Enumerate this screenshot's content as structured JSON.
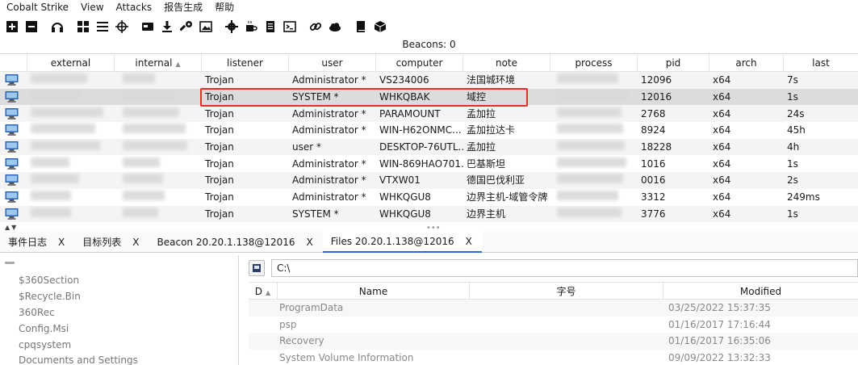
{
  "menu": [
    "Cobalt Strike",
    "View",
    "Attacks",
    "报告生成",
    "帮助"
  ],
  "toolbar_icons": [
    "plus-icon",
    "minus-icon",
    "headphones-icon",
    "targets-icon",
    "list-icon",
    "crosshair-icon",
    "credit-card-icon",
    "download-icon",
    "key-icon",
    "image-icon",
    "gear-icon",
    "coffee-icon",
    "document-icon",
    "terminal-icon",
    "link-icon",
    "cloud-icon",
    "book-icon",
    "cube-icon"
  ],
  "beacons_label": "Beacons: 0",
  "columns": [
    "external",
    "internal",
    "listener",
    "user",
    "computer",
    "note",
    "process",
    "pid",
    "arch",
    "last"
  ],
  "rows": [
    {
      "listener": "Trojan",
      "user": "Administrator *",
      "computer": "VS234006",
      "note": "法国城环境",
      "pid": "12096",
      "arch": "x64",
      "last": "7s"
    },
    {
      "listener": "Trojan",
      "user": "SYSTEM *",
      "computer": "WHKQBAK",
      "note": "域控",
      "pid": "12016",
      "arch": "x64",
      "last": "1s"
    },
    {
      "listener": "Trojan",
      "user": "Administrator *",
      "computer": "PARAMOUNT",
      "note": "孟加拉",
      "pid": "2768",
      "arch": "x64",
      "last": "24s"
    },
    {
      "listener": "Trojan",
      "user": "Administrator *",
      "computer": "WIN-H62ONMC...",
      "note": "孟加拉达卡",
      "pid": "8924",
      "arch": "x64",
      "last": "45h"
    },
    {
      "listener": "Trojan",
      "user": "user *",
      "computer": "DESKTOP-76UTL...",
      "note": "孟加拉",
      "pid": "18228",
      "arch": "x64",
      "last": "4h"
    },
    {
      "listener": "Trojan",
      "user": "Administrator *",
      "computer": "WIN-869HAO701...",
      "note": "巴基斯坦",
      "pid": "1016",
      "arch": "x64",
      "last": "1s"
    },
    {
      "listener": "Trojan",
      "user": "Administrator *",
      "computer": "VTXW01",
      "note": "德国巴伐利亚",
      "pid": "0016",
      "arch": "x64",
      "last": "2s"
    },
    {
      "listener": "Trojan",
      "user": "Administrator *",
      "computer": "WHKQGU8",
      "note": "边界主机-域管令牌",
      "pid": "3312",
      "arch": "x64",
      "last": "249ms"
    },
    {
      "listener": "Trojan",
      "user": "SYSTEM *",
      "computer": "WHKQGU8",
      "note": "边界主机",
      "pid": "3776",
      "arch": "x64",
      "last": "1s"
    }
  ],
  "tabs": [
    {
      "label": "事件日志",
      "close": "X"
    },
    {
      "label": "目标列表",
      "close": "X"
    },
    {
      "label": "Beacon 20.20.1.138@12016",
      "close": "X"
    },
    {
      "label": "Files 20.20.1.138@12016",
      "close": "X"
    }
  ],
  "tree": [
    "$360Section",
    "$Recycle.Bin",
    "360Rec",
    "Config.Msi",
    "cpqsystem",
    "Documents and Settings"
  ],
  "path_value": "C:\\",
  "file_columns": [
    "D",
    "Name",
    "字号",
    "Modified"
  ],
  "files": [
    {
      "name": "ProgramData",
      "size": "",
      "modified": "03/25/2022 15:37:35"
    },
    {
      "name": "psp",
      "size": "",
      "modified": "01/16/2017 17:16:44"
    },
    {
      "name": "Recovery",
      "size": "",
      "modified": "01/16/2017 16:35:06"
    },
    {
      "name": "System Volume Information",
      "size": "",
      "modified": "09/09/2022 13:32:33"
    }
  ]
}
